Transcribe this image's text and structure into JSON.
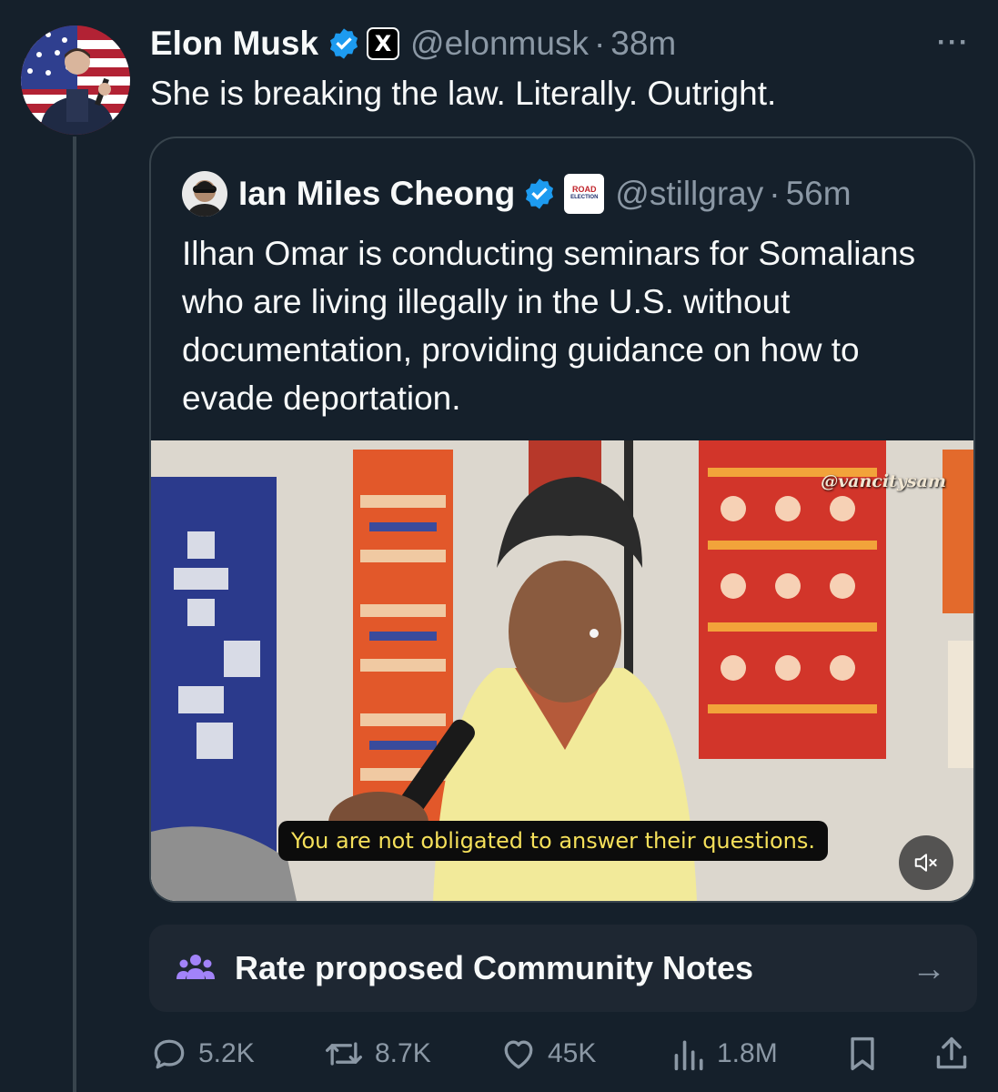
{
  "post": {
    "author_name": "Elon Musk",
    "handle": "@elonmusk",
    "separator": "·",
    "time": "38m",
    "badge": "X",
    "text": "She is breaking the law. Literally. Outright.",
    "more_label": "···"
  },
  "quote": {
    "author_name": "Ian Miles Cheong",
    "handle": "@stillgray",
    "separator": "·",
    "time": "56m",
    "badge_line1": "ROAD",
    "badge_line2": "ELECTION",
    "text": "Ilhan Omar is conducting seminars for Somalians who are living illegally in the U.S. without documentation, providing guidance on how to evade deportation.",
    "media": {
      "watermark": "@vancitysam",
      "caption": "You are not obligated to answer their questions.",
      "mute_icon": "speaker-muted-icon"
    }
  },
  "community_notes": {
    "label": "Rate proposed Community Notes",
    "arrow": "→",
    "icon": "people-group-icon",
    "accent": "#a283f9"
  },
  "actions": {
    "replies": "5.2K",
    "reposts": "8.7K",
    "likes": "45K",
    "views": "1.8M"
  },
  "colors": {
    "background": "#15202b",
    "text": "#f7f9f9",
    "muted": "#8b98a5",
    "verified": "#1d9bf0",
    "border": "#38444d"
  }
}
